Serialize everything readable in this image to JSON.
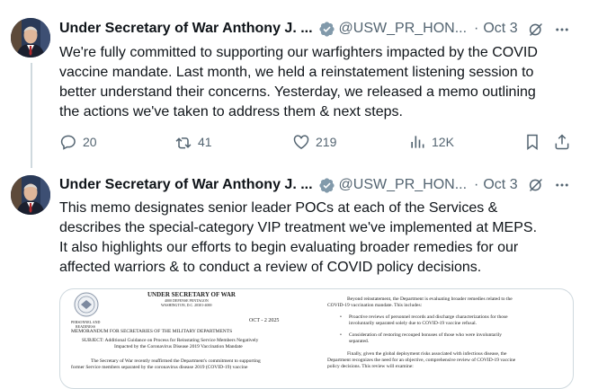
{
  "tweets": [
    {
      "author_name": "Under Secretary of War Anthony J. ...",
      "handle": "@USW_PR_HON...",
      "separator": "·",
      "date": "Oct 3",
      "lines": [
        "We're fully committed to supporting our warfighters impacted by the COVID",
        "vaccine mandate. Last month, we held a reinstatement listening session to",
        "better understand their concerns. Yesterday, we released a memo outlining",
        "the actions we've taken to address them & next steps."
      ],
      "stats": {
        "replies": "20",
        "reposts": "41",
        "likes": "219",
        "views": "12K"
      }
    },
    {
      "author_name": "Under Secretary of War Anthony J. ...",
      "handle": "@USW_PR_HON...",
      "separator": "·",
      "date": "Oct 3",
      "lines": [
        "This memo designates senior leader POCs at each of the Services &",
        "describes the special-category VIP treatment we've implemented at MEPS.",
        "It also highlights our efforts to begin evaluating broader remedies for our",
        "affected warriors & to conduct a review of COVID policy decisions."
      ]
    }
  ],
  "memo": {
    "office": "UNDER SECRETARY OF WAR",
    "address_1": "4000 DEFENSE PENTAGON",
    "address_2": "WASHINGTON, D.C. 20301-4000",
    "seal_caption_1": "PERSONNEL AND",
    "seal_caption_2": "READINESS",
    "date": "OCT - 2 2025",
    "to_line": "MEMORANDUM FOR SECRETARIES OF THE MILITARY DEPARTMENTS",
    "subject_1": "SUBJECT:  Additional Guidance on Process for Reinstating Service Members Negatively",
    "subject_2": "Impacted by the Coronavirus Disease 2019 Vaccination Mandate",
    "para_1": "The Secretary of War recently reaffirmed the Department's commitment to supporting",
    "para_2": "former Service members separated by the coronavirus disease 2019 (COVID-19) vaccine",
    "right_1": "Beyond reinstatement, the Department is evaluating broader remedies related to the",
    "right_2": "COVID-19 vaccination mandate. This includes:",
    "bullet_1a": "Proactive reviews of personnel records and discharge characterizations for those",
    "bullet_1b": "involuntarily separated solely due to COVID-19 vaccine refusal.",
    "bullet_2a": "Consideration of restoring recouped bonuses of those who were involuntarily",
    "bullet_2b": "separated.",
    "right_3": "Finally, given the global deployment risks associated with infectious disease, the",
    "right_4": "Department recognizes the need for an objective, comprehensive review of COVID-19 vaccine",
    "right_5": "policy decisions. This review will examine:"
  },
  "colors": {
    "text": "#0f1419",
    "muted": "#536471",
    "verified": "#829aab",
    "divider": "#cfd9de"
  },
  "icons": [
    "verified-badge-icon",
    "grok-icon",
    "more-icon",
    "reply-icon",
    "repost-icon",
    "like-icon",
    "views-icon",
    "bookmark-icon",
    "share-icon"
  ]
}
